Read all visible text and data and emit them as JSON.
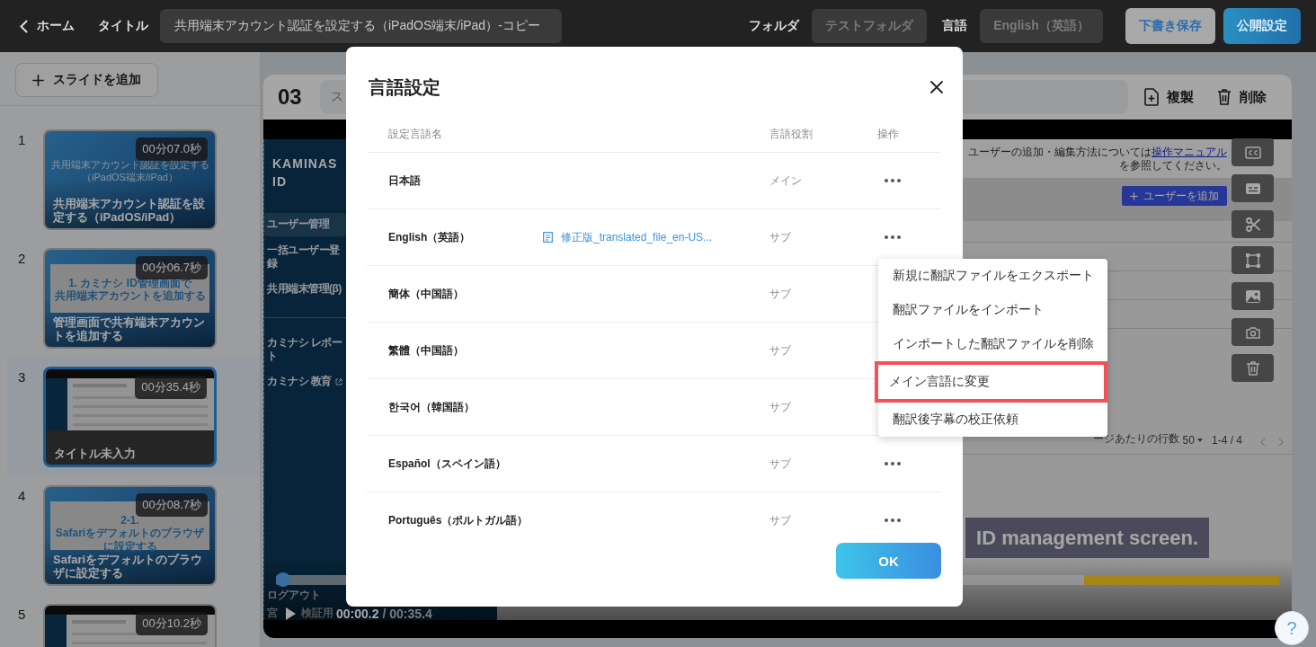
{
  "topbar": {
    "back_link": "ホーム",
    "title_label": "タイトル",
    "title_value": "共用端末アカウント認証を設定する（iPadOS端末/iPad）-コピー",
    "folder_label": "フォルダ",
    "folder_value": "テストフォルダ",
    "language_label": "言語",
    "language_value": "English（英語）",
    "buttons": [
      {
        "label": "下書き保存",
        "kind": "draft"
      },
      {
        "label": "公開設定",
        "kind": "publish"
      }
    ]
  },
  "sidebar": {
    "add_button": "スライドを追加",
    "slides": [
      {
        "number": "1",
        "duration": "00分07.0秒",
        "title": "共用端末アカウント認証を設定する（iPadOS/iPad）",
        "thumbnail": {
          "kind": "title",
          "text": [
            "共用端末アカウント認証を設定する",
            "（iPadOS端末/iPad）"
          ]
        },
        "selected": false
      },
      {
        "number": "2",
        "duration": "00分06.7秒",
        "title": "管理画面で共有端末アカウントを追加する",
        "thumbnail": {
          "kind": "card",
          "text": [
            "1. カミナシ ID管理画面で",
            "共用端末アカウントを追加する"
          ]
        },
        "selected": false
      },
      {
        "number": "3",
        "duration": "00分35.4秒",
        "title": "タイトル未入力",
        "thumbnail": {
          "kind": "screenshot"
        },
        "selected": true
      },
      {
        "number": "4",
        "duration": "00分08.7秒",
        "title": "Safariをデフォルトのブラウザに設定する",
        "thumbnail": {
          "kind": "card",
          "text": [
            "2-1.",
            "Safariをデフォルトのブラウザに設定する"
          ]
        },
        "selected": false
      },
      {
        "number": "5",
        "duration": "00分10.2秒",
        "thumbnail": {
          "kind": "screenshot"
        },
        "selected": false
      }
    ]
  },
  "editor": {
    "number": "03",
    "title_placeholder": "ス",
    "actions": [
      {
        "label": "複製",
        "kind": "duplicate"
      },
      {
        "label": "削除",
        "kind": "delete"
      }
    ],
    "video": {
      "nav": {
        "logo": [
          "KAMINAS",
          "ID"
        ],
        "items": [
          {
            "label": "ユーザー管理",
            "selected": true
          },
          {
            "label": "一括ユーザー登録",
            "selected": false
          },
          {
            "label": "共用端末管理(β)",
            "selected": false
          }
        ],
        "links": [
          {
            "label": "カミナシ レポート",
            "external": false
          },
          {
            "label": "カミナシ 教育",
            "external": true
          }
        ],
        "logout": "ログアウト",
        "account": [
          "宮",
          "検証用"
        ]
      },
      "notice": {
        "before": "ユーザーの追加・編集方法については",
        "link": "操作マニュアル",
        "after": "を参照してください。"
      },
      "add_user_button": "ユーザーを追加",
      "pagination": {
        "rows_label": "ージあたりの行数",
        "rows_value": "50",
        "range": "1-4 / 4"
      },
      "caption": "ID management screen.",
      "progress": {
        "level": 0.007
      },
      "time": {
        "current": "00:00.2",
        "total": "/ 00:35.4"
      }
    }
  },
  "dialog": {
    "title": "言語設定",
    "columns": [
      "設定言語名",
      "言語役割",
      "操作"
    ],
    "rows": [
      {
        "language": "日本語",
        "role": "メイン"
      },
      {
        "language": "English（英語）",
        "file": "修正版_translated_file_en-US...",
        "role": "サブ"
      },
      {
        "language": "簡体（中国語）",
        "role": "サブ"
      },
      {
        "language": "繁體（中国語）",
        "role": "サブ"
      },
      {
        "language": "한국어（韓国語）",
        "role": "サブ"
      },
      {
        "language": "Español（スペイン語）",
        "role": "サブ"
      },
      {
        "language": "Português（ポルトガル語）",
        "role": "サブ"
      }
    ],
    "menu": {
      "items": [
        {
          "label": "新規に翻訳ファイルをエクスポート",
          "highlighted": false
        },
        {
          "label": "翻訳ファイルをインポート",
          "highlighted": false
        },
        {
          "label": "インポートした翻訳ファイルを削除",
          "highlighted": false
        },
        {
          "label": "メイン言語に変更",
          "highlighted": true
        },
        {
          "label": "翻訳後字幕の校正依頼",
          "highlighted": false
        }
      ]
    },
    "ok_button": "OK"
  },
  "help_button": "?"
}
